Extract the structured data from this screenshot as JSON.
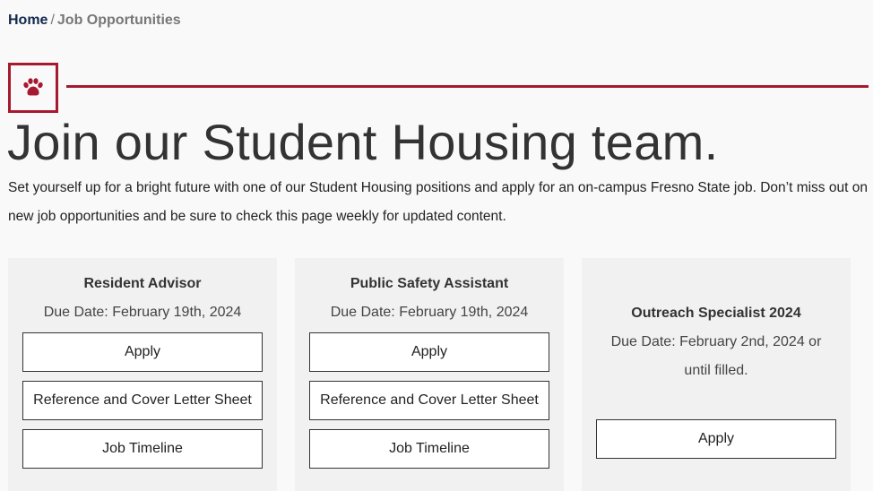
{
  "breadcrumb": {
    "home": "Home",
    "separator": "/",
    "current": "Job Opportunities"
  },
  "icon": "paw-icon",
  "headline": "Join our Student Housing team.",
  "intro": "Set yourself up for a bright future with one of our Student Housing positions and apply for an on-campus Fresno State job. Don’t miss out on new job opportunities and be sure to check this page weekly for updated content.",
  "colors": {
    "accent": "#a6192e",
    "link": "#13284c",
    "card_bg": "#f1f1f1",
    "page_bg": "#f9f9f9"
  },
  "cards": [
    {
      "title": "Resident Advisor",
      "due": "Due Date: February 19th, 2024",
      "buttons": [
        "Apply",
        "Reference and Cover Letter Sheet",
        "Job Timeline"
      ]
    },
    {
      "title": "Public Safety Assistant",
      "due": "Due Date: February 19th, 2024",
      "buttons": [
        "Apply",
        "Reference and Cover Letter Sheet",
        "Job Timeline"
      ]
    },
    {
      "title": "Outreach Specialist 2024",
      "due": "Due Date: February 2nd, 2024 or until filled.",
      "buttons": [
        "Apply"
      ]
    }
  ]
}
